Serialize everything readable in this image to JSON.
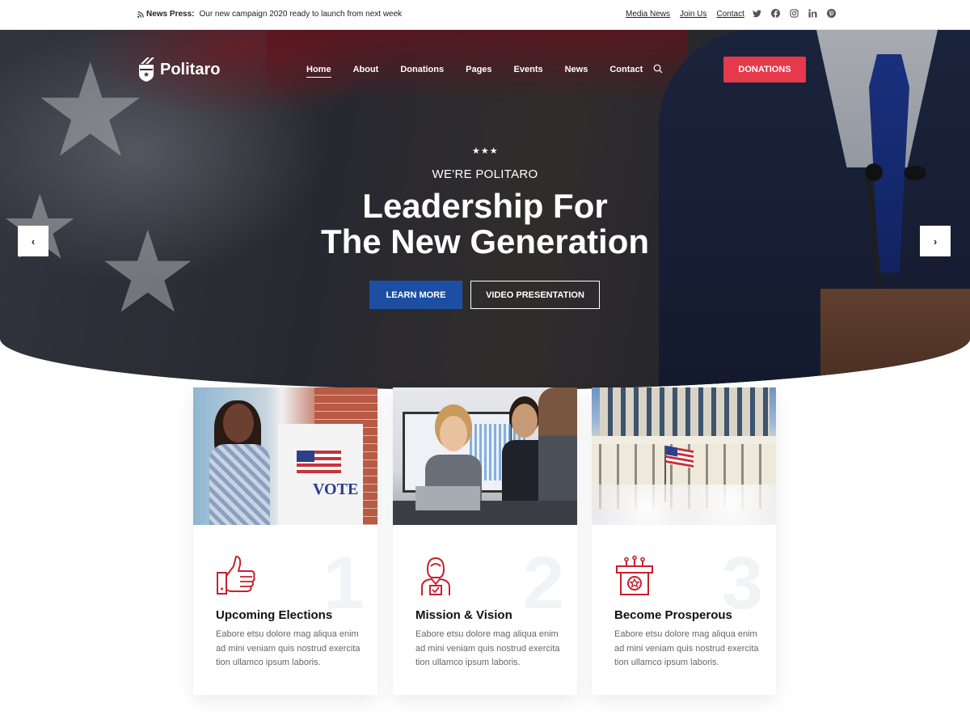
{
  "topbar": {
    "news_label": "News Press:",
    "news_text": "Our new campaign 2020 ready to launch from next week",
    "links": [
      "Media News",
      "Join Us",
      "Contact"
    ],
    "social_icons": [
      "twitter-icon",
      "facebook-icon",
      "instagram-icon",
      "linkedin-icon",
      "pinterest-icon"
    ]
  },
  "brand": {
    "name": "Politaro"
  },
  "nav": {
    "items": [
      "Home",
      "About",
      "Donations",
      "Pages",
      "Events",
      "News",
      "Contact"
    ],
    "active": "Home",
    "cta": "DONATIONS"
  },
  "hero": {
    "stars": "★★★",
    "eyebrow": "WE'RE POLITARO",
    "headline_line1": "Leadership For",
    "headline_line2": "The New Generation",
    "primary_button": "LEARN MORE",
    "secondary_button": "VIDEO PRESENTATION",
    "prev_arrow": "‹",
    "next_arrow": "›"
  },
  "cards": [
    {
      "number": "1",
      "title": "Upcoming Elections",
      "text": "Eabore etsu dolore mag aliqua enim ad mini veniam quis nostrud exercita tion ullamco ipsum laboris.",
      "icon": "thumbs-up-icon",
      "photo_text": "VOTE"
    },
    {
      "number": "2",
      "title": "Mission & Vision",
      "text": "Eabore etsu dolore mag aliqua enim ad mini veniam quis nostrud exercita tion ullamco ipsum laboris.",
      "icon": "candidate-icon"
    },
    {
      "number": "3",
      "title": "Become Prosperous",
      "text": "Eabore etsu dolore mag aliqua enim ad mini veniam quis nostrud exercita tion ullamco ipsum laboris.",
      "icon": "podium-star-icon"
    }
  ],
  "colors": {
    "accent_red": "#e6394c",
    "primary_blue": "#1c4fa3",
    "icon_red": "#c8202f"
  }
}
